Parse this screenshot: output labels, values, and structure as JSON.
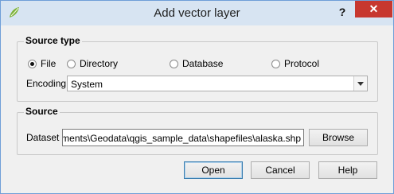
{
  "window": {
    "title": "Add vector layer",
    "help_glyph": "?",
    "close_glyph": "✕"
  },
  "source_type": {
    "title": "Source type",
    "options": [
      {
        "label": "File",
        "checked": true
      },
      {
        "label": "Directory",
        "checked": false
      },
      {
        "label": "Database",
        "checked": false
      },
      {
        "label": "Protocol",
        "checked": false
      }
    ],
    "encoding_label": "Encoding",
    "encoding_value": "System"
  },
  "source": {
    "title": "Source",
    "dataset_label": "Dataset",
    "dataset_value": "\\Documents\\Geodata\\qgis_sample_data\\shapefiles\\alaska.shp",
    "browse_label": "Browse"
  },
  "buttons": {
    "open": "Open",
    "cancel": "Cancel",
    "help": "Help"
  },
  "colors": {
    "close_bg": "#c7372f",
    "title_bg": "#d7e4f2",
    "window_border": "#6f9ed8"
  }
}
